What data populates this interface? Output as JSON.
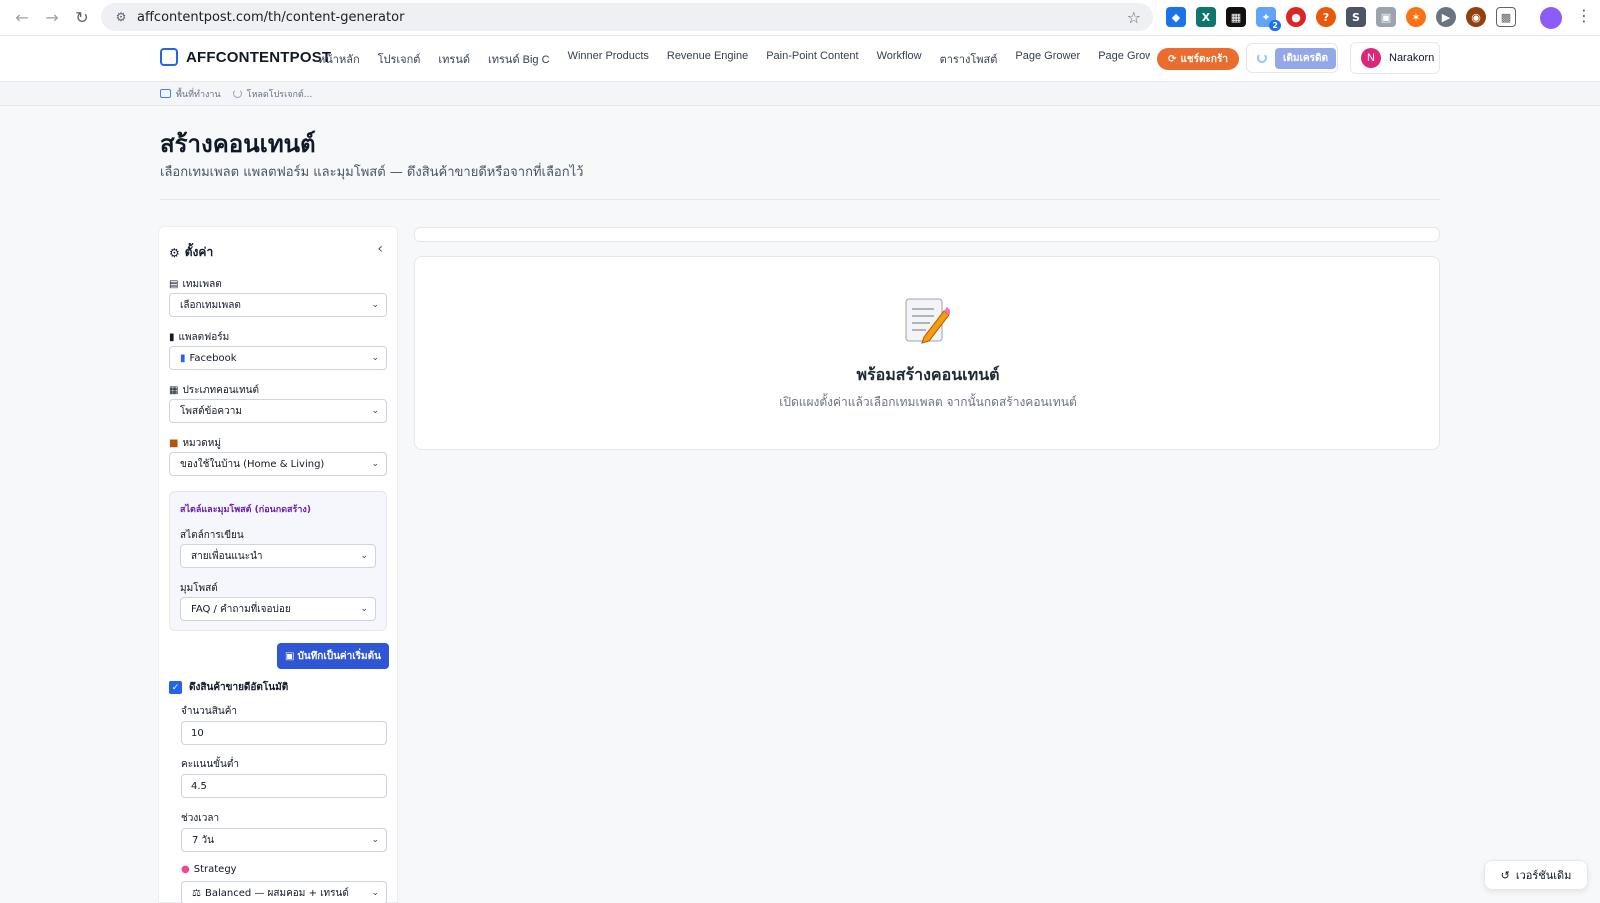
{
  "browser": {
    "url": "affcontentpost.com/th/content-generator",
    "extension_badge": "2"
  },
  "header": {
    "brand": "AFFCONTENTPOST",
    "nav": [
      "หน้าหลัก",
      "โปรเจกต์",
      "เทรนด์",
      "เทรนด์ Big C",
      "Winner Products",
      "Revenue Engine",
      "Pain-Point Content",
      "Workflow",
      "ตารางโพสต์",
      "Page Grower",
      "Page Grower + AI"
    ],
    "share_label": "แชร์ตะกร้า",
    "credit_label": "เติมเครดิต",
    "user_initial": "N",
    "user_name": "Narakorn"
  },
  "breadcrumb": {
    "workspace": "พื้นที่ทำงาน",
    "loading": "โหลดโปรเจกต์..."
  },
  "page": {
    "title": "สร้างคอนเทนต์",
    "subtitle": "เลือกเทมเพลต แพลตฟอร์ม และมุมโพสต์ — ดึงสินค้าขายดีหรือจากที่เลือกไว้"
  },
  "settings": {
    "title": "ตั้งค่า",
    "template_label": "เทมเพลต",
    "template_value": "เลือกเทมเพลต",
    "platform_label": "แพลตฟอร์ม",
    "platform_value": "Facebook",
    "content_type_label": "ประเภทคอนเทนต์",
    "content_type_value": "โพสต์ข้อความ",
    "category_label": "หมวดหมู่",
    "category_value": "ของใช้ในบ้าน (Home & Living)",
    "style_box_title": "สไตล์และมุมโพสต์ (ก่อนกดสร้าง)",
    "writing_style_label": "สไตล์การเขียน",
    "writing_style_value": "สายเพื่อนแนะนำ",
    "angle_label": "มุมโพสต์",
    "angle_value": "FAQ / คำถามที่เจอบ่อย",
    "save_default_label": "บันทึกเป็นค่าเริ่มต้น",
    "auto_fetch_label": "ดึงสินค้าขายดีอัตโนมัติ",
    "product_count_label": "จำนวนสินค้า",
    "product_count_value": "10",
    "min_rating_label": "คะแนนขั้นต่ำ",
    "min_rating_value": "4.5",
    "period_label": "ช่วงเวลา",
    "period_value": "7 วัน",
    "strategy_label": "Strategy",
    "strategy_value": "Balanced — ผสมคอม + เทรนด์"
  },
  "main": {
    "ready_title": "พร้อมสร้างคอนเทนต์",
    "ready_sub": "เปิดแผงตั้งค่าแล้วเลือกเทมเพลต จากนั้นกดสร้างคอนเทนต์"
  },
  "version_label": "เวอร์ชันเดิม"
}
